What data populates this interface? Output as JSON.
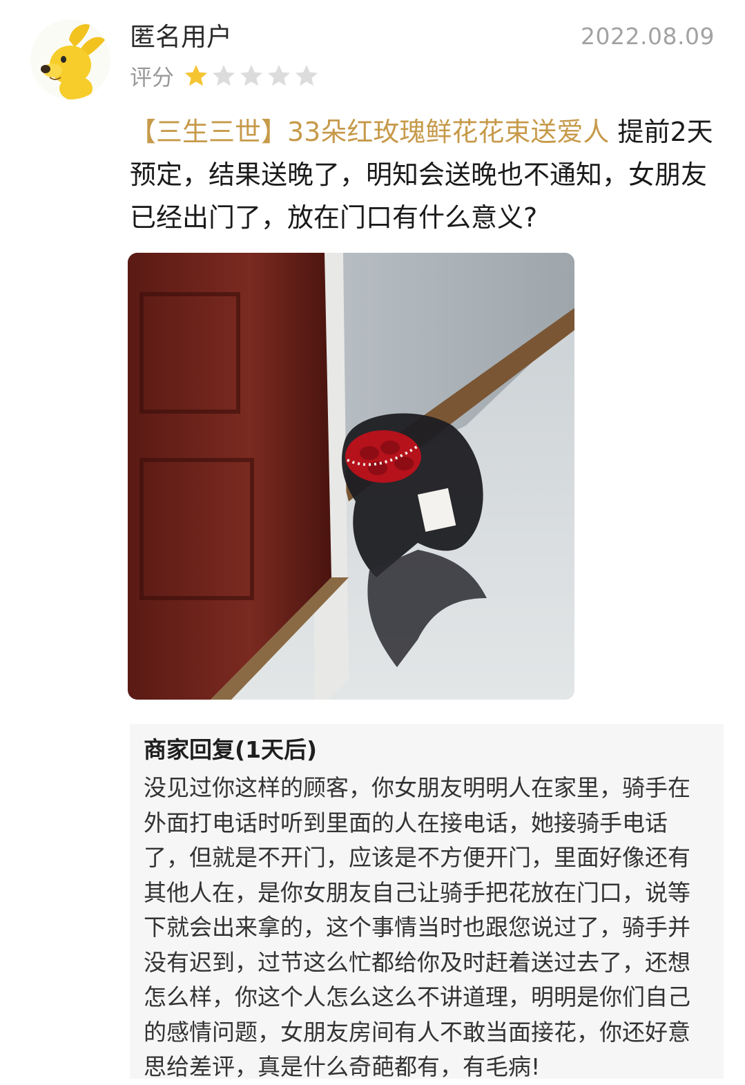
{
  "review": {
    "username": "匿名用户",
    "date": "2022.08.09",
    "rating_label": "评分",
    "rating": 1,
    "rating_max": 5,
    "product_link": "【三生三世】33朵红玫瑰鲜花花束送爱人",
    "text": " 提前2天预定，结果送晚了，明知会送晚也不通知，女朋友已经出门了，放在门口有什么意义?"
  },
  "reply": {
    "title": "商家回复(1天后)",
    "text": "没见过你这样的顾客，你女朋友明明人在家里，骑手在外面打电话时听到里面的人在接电话，她接骑手电话了，但就是不开门，应该是不方便开门，里面好像还有其他人在，是你女朋友自己让骑手把花放在门口，说等下就会出来拿的，这个事情当时也跟您说过了，骑手并没有迟到，过节这么忙都给你及时赶着送过去了，还想怎么样，你这个人怎么这么不讲道理，明明是你们自己的感情问题，女朋友房间有人不敢当面接花，你还好意思给差评，真是什么奇葩都有，有毛病!"
  },
  "icons": {
    "avatar": "yellow-dog-avatar-icon",
    "star_filled": "star-filled-icon",
    "star_empty": "star-empty-icon"
  },
  "colors": {
    "product_link": "#c69a4a",
    "star_filled": "#f5c431",
    "star_empty": "#dcdcdc",
    "meta_text": "#9a9a9a",
    "reply_background": "#f6f6f6"
  }
}
